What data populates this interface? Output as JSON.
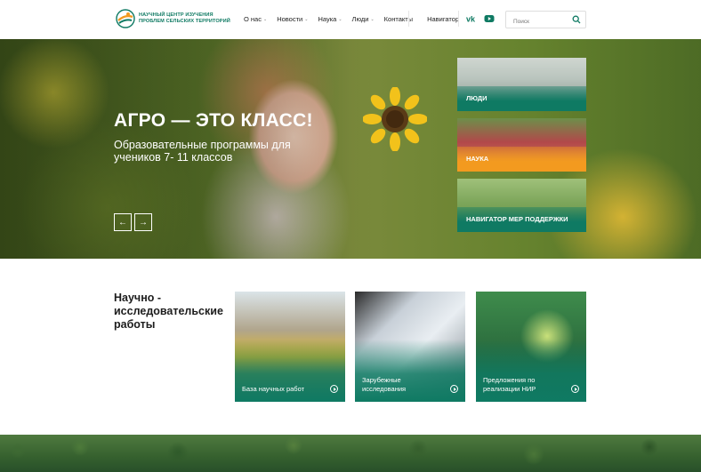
{
  "header": {
    "logo_line1": "Научный центр изучения",
    "logo_line2": "проблем сельских территорий",
    "nav": [
      {
        "label": "О нас",
        "has_dropdown": true
      },
      {
        "label": "Новости",
        "has_dropdown": true
      },
      {
        "label": "Наука",
        "has_dropdown": true
      },
      {
        "label": "Люди",
        "has_dropdown": true
      },
      {
        "label": "Контакты",
        "has_dropdown": false
      },
      {
        "label": "Навигатор",
        "has_dropdown": false
      }
    ],
    "social": [
      {
        "icon": "vk-icon"
      },
      {
        "icon": "youtube-icon"
      }
    ],
    "search_placeholder": "Поиск"
  },
  "hero": {
    "title": "АГРО — ЭТО КЛАСС!",
    "subtitle": "Образовательные программы для учеников 7- 11 классов",
    "prev_icon": "arrow-left-icon",
    "next_icon": "arrow-right-icon",
    "side_cards": [
      {
        "label": "ЛЮДИ",
        "color": "#0f7a63"
      },
      {
        "label": "НАУКА",
        "color": "#f39a1f"
      },
      {
        "label": "НАВИГАТОР МЕР ПОДДЕРЖКИ",
        "color": "#0f7a63"
      }
    ]
  },
  "research": {
    "title": "Научно - исследовательские работы",
    "cards": [
      {
        "label": "База научных работ"
      },
      {
        "label": "Зарубежные исследования"
      },
      {
        "label": "Предложения по реализации НИР"
      }
    ]
  },
  "colors": {
    "brand_green": "#0f7a63",
    "accent_orange": "#f39a1f"
  }
}
